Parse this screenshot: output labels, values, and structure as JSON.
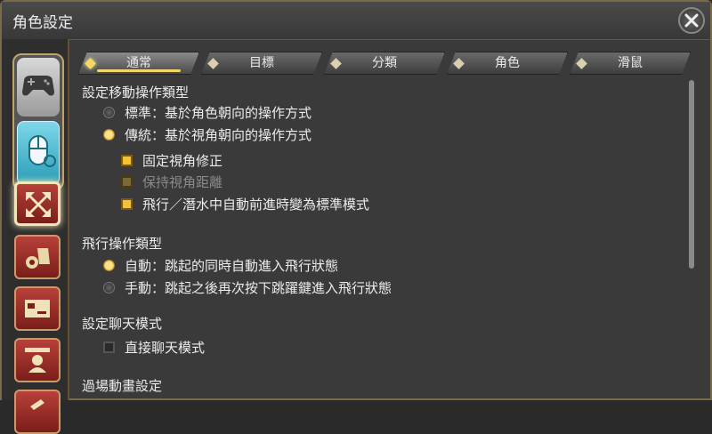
{
  "window": {
    "title": "角色設定"
  },
  "tabs": [
    {
      "label": "通常",
      "active": true
    },
    {
      "label": "目標",
      "active": false
    },
    {
      "label": "分類",
      "active": false
    },
    {
      "label": "角色",
      "active": false
    },
    {
      "label": "滑鼠",
      "active": false
    }
  ],
  "sections": {
    "move": {
      "title": "設定移動操作類型",
      "standard": "標準：基於角色朝向的操作方式",
      "legacy": "傳統：基於視角朝向的操作方式",
      "fix_camera": "固定視角修正",
      "keep_distance": "保持視角距離",
      "auto_forward": "飛行／潛水中自動前進時變為標準模式"
    },
    "flight": {
      "title": "飛行操作類型",
      "auto": "自動：跳起的同時自動進入飛行狀態",
      "manual": "手動：跳起之後再次按下跳躍鍵進入飛行狀態"
    },
    "chat": {
      "title": "設定聊天模式",
      "direct": "直接聊天模式"
    },
    "cutscene": {
      "title": "過場動畫設定"
    }
  },
  "colors": {
    "accent": "#f2c23a",
    "frame": "#bfa46a",
    "category": "#b8403a"
  }
}
